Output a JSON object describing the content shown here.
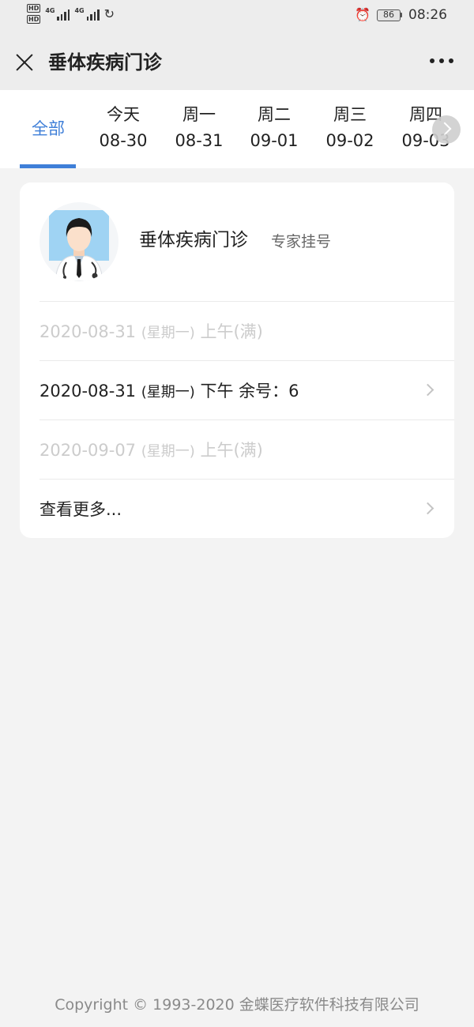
{
  "status_bar": {
    "hd_label": "HD",
    "signal_tag_1": "4G",
    "signal_tag_2": "4G",
    "battery_level": "86",
    "time": "08:26"
  },
  "header": {
    "title": "垂体疾病门诊"
  },
  "date_tabs": {
    "all_label": "全部",
    "selected": "全部",
    "days": [
      {
        "day": "今天",
        "date": "08-30"
      },
      {
        "day": "周一",
        "date": "08-31"
      },
      {
        "day": "周二",
        "date": "09-01"
      },
      {
        "day": "周三",
        "date": "09-02"
      },
      {
        "day": "周四",
        "date": "09-03"
      }
    ]
  },
  "clinic": {
    "name": "垂体疾病门诊",
    "registration_type": "专家挂号",
    "schedules": [
      {
        "date": "2020-08-31",
        "weekday": "(星期一)",
        "period": "上午(满)",
        "available": false
      },
      {
        "date": "2020-08-31",
        "weekday": "(星期一)",
        "period": "下午 余号：6",
        "available": true
      },
      {
        "date": "2020-09-07",
        "weekday": "(星期一)",
        "period": "上午(满)",
        "available": false
      }
    ],
    "more_label": "查看更多..."
  },
  "footer": {
    "copyright": "Copyright © 1993-2020 金蝶医疗软件科技有限公司"
  },
  "colors": {
    "accent": "#3f7fd8",
    "disabled_text": "#cccccc",
    "page_background": "#f3f3f3",
    "bar_background": "#ededed"
  },
  "icons": [
    "close-icon",
    "more-icon",
    "chevron-right-icon",
    "doctor-avatar",
    "alarm-icon",
    "battery-icon",
    "signal-icon"
  ]
}
